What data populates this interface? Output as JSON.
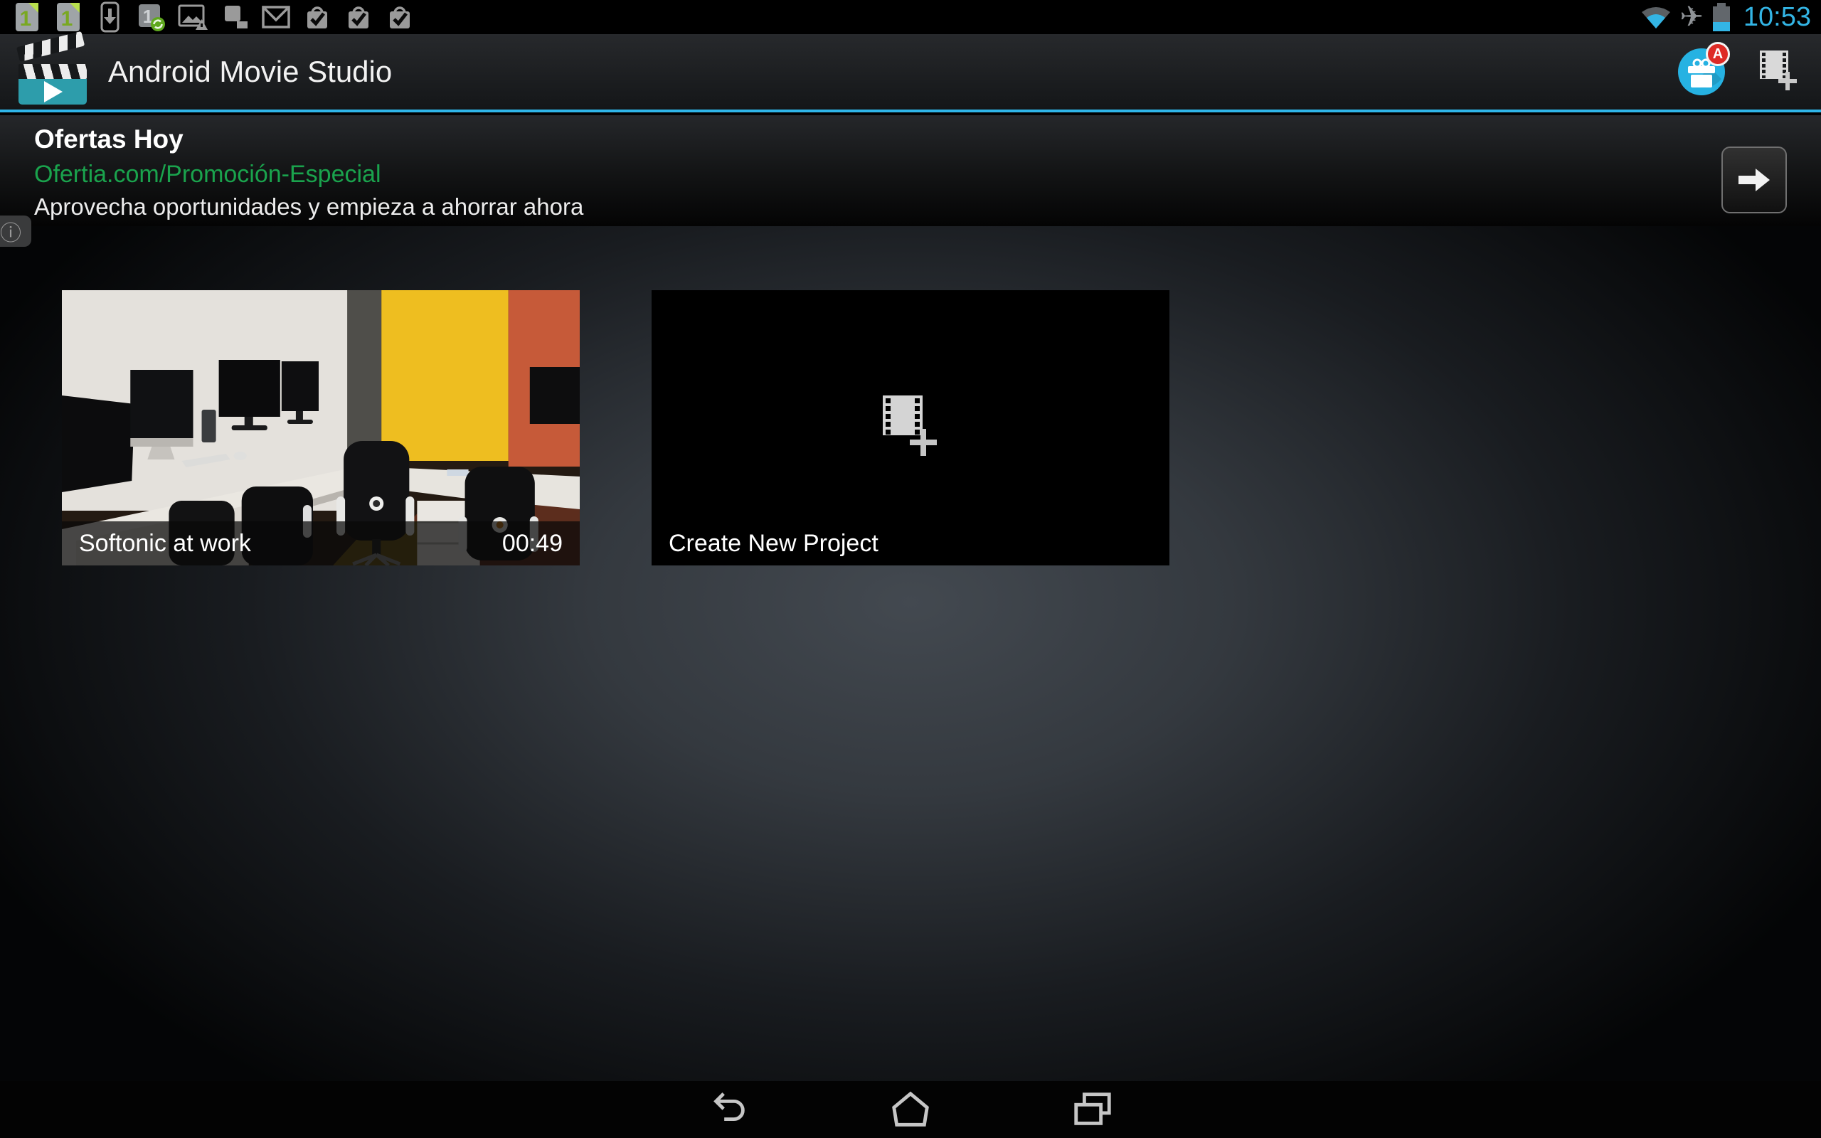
{
  "status_bar": {
    "time": "10:53",
    "one_label": "1",
    "notification_icons": [
      "one-lite-icon",
      "one-lite-icon",
      "download-icon",
      "one-sync-icon",
      "gallery-warning-icon",
      "screenshot-squares-icon",
      "gmail-icon",
      "playstore-check-icon",
      "playstore-check-icon",
      "playstore-check-icon"
    ],
    "system_icons": [
      "wifi-icon",
      "airplane-mode-icon",
      "battery-icon"
    ],
    "accent_color": "#33b5e5"
  },
  "action_bar": {
    "app_title": "Android Movie Studio",
    "badge_letter": "A",
    "underline_color": "#33b5e5",
    "icons": [
      "clapperboard-app-icon",
      "gift-offers-icon",
      "new-project-film-icon"
    ]
  },
  "ad_banner": {
    "headline": "Ofertas Hoy",
    "link": "Ofertia.com/Promoción-Especial",
    "body": "Aprovecha oportunidades y empieza a ahorrar ahora",
    "link_color": "#1aa34d",
    "info_symbol": "ⓘ",
    "arrow_icon": "right-arrow-icon"
  },
  "projects": {
    "items": [
      {
        "title": "Softonic at work",
        "duration": "00:49",
        "type": "video"
      },
      {
        "title": "Create New Project",
        "type": "new"
      }
    ]
  },
  "nav_bar": {
    "buttons": [
      "back",
      "home",
      "recents"
    ]
  }
}
